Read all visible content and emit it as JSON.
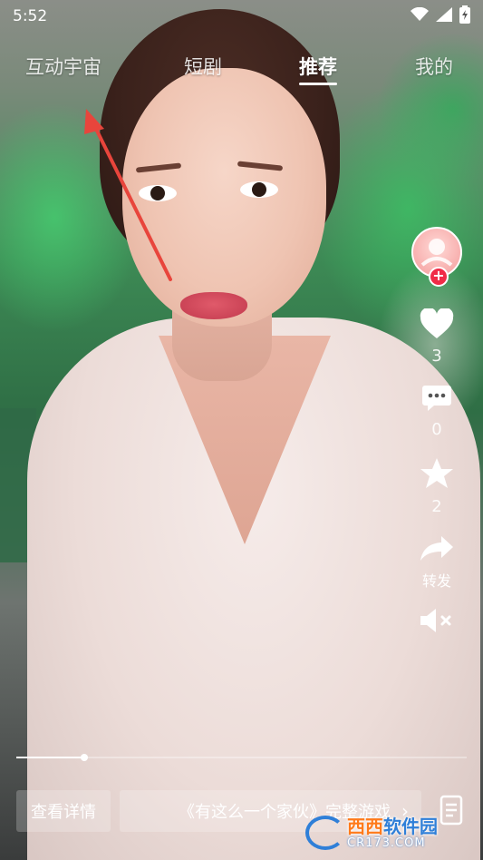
{
  "status_bar": {
    "time": "5:52"
  },
  "tabs": [
    {
      "label": "互动宇宙"
    },
    {
      "label": "短剧"
    },
    {
      "label": "推荐",
      "active": true
    },
    {
      "label": "我的"
    }
  ],
  "actions": {
    "like": {
      "icon": "heart-icon",
      "count": "3"
    },
    "comment": {
      "icon": "comment-icon",
      "count": "0"
    },
    "favorite": {
      "icon": "star-icon",
      "count": "2"
    },
    "share": {
      "icon": "share-icon",
      "label": "转发"
    },
    "mute": {
      "icon": "speaker-muted-icon"
    }
  },
  "progress": {
    "fraction": 0.15
  },
  "bottom": {
    "detail_label": "查看详情",
    "game_label": "《有这么一个家伙》完整游戏"
  },
  "watermark": {
    "title_a": "西西",
    "title_b": "软件园",
    "sub": "CR173.COM"
  },
  "colors": {
    "accent_red": "#f02b47",
    "arrow_red": "#e8453c",
    "watermark_blue": "#2f7fd8"
  }
}
